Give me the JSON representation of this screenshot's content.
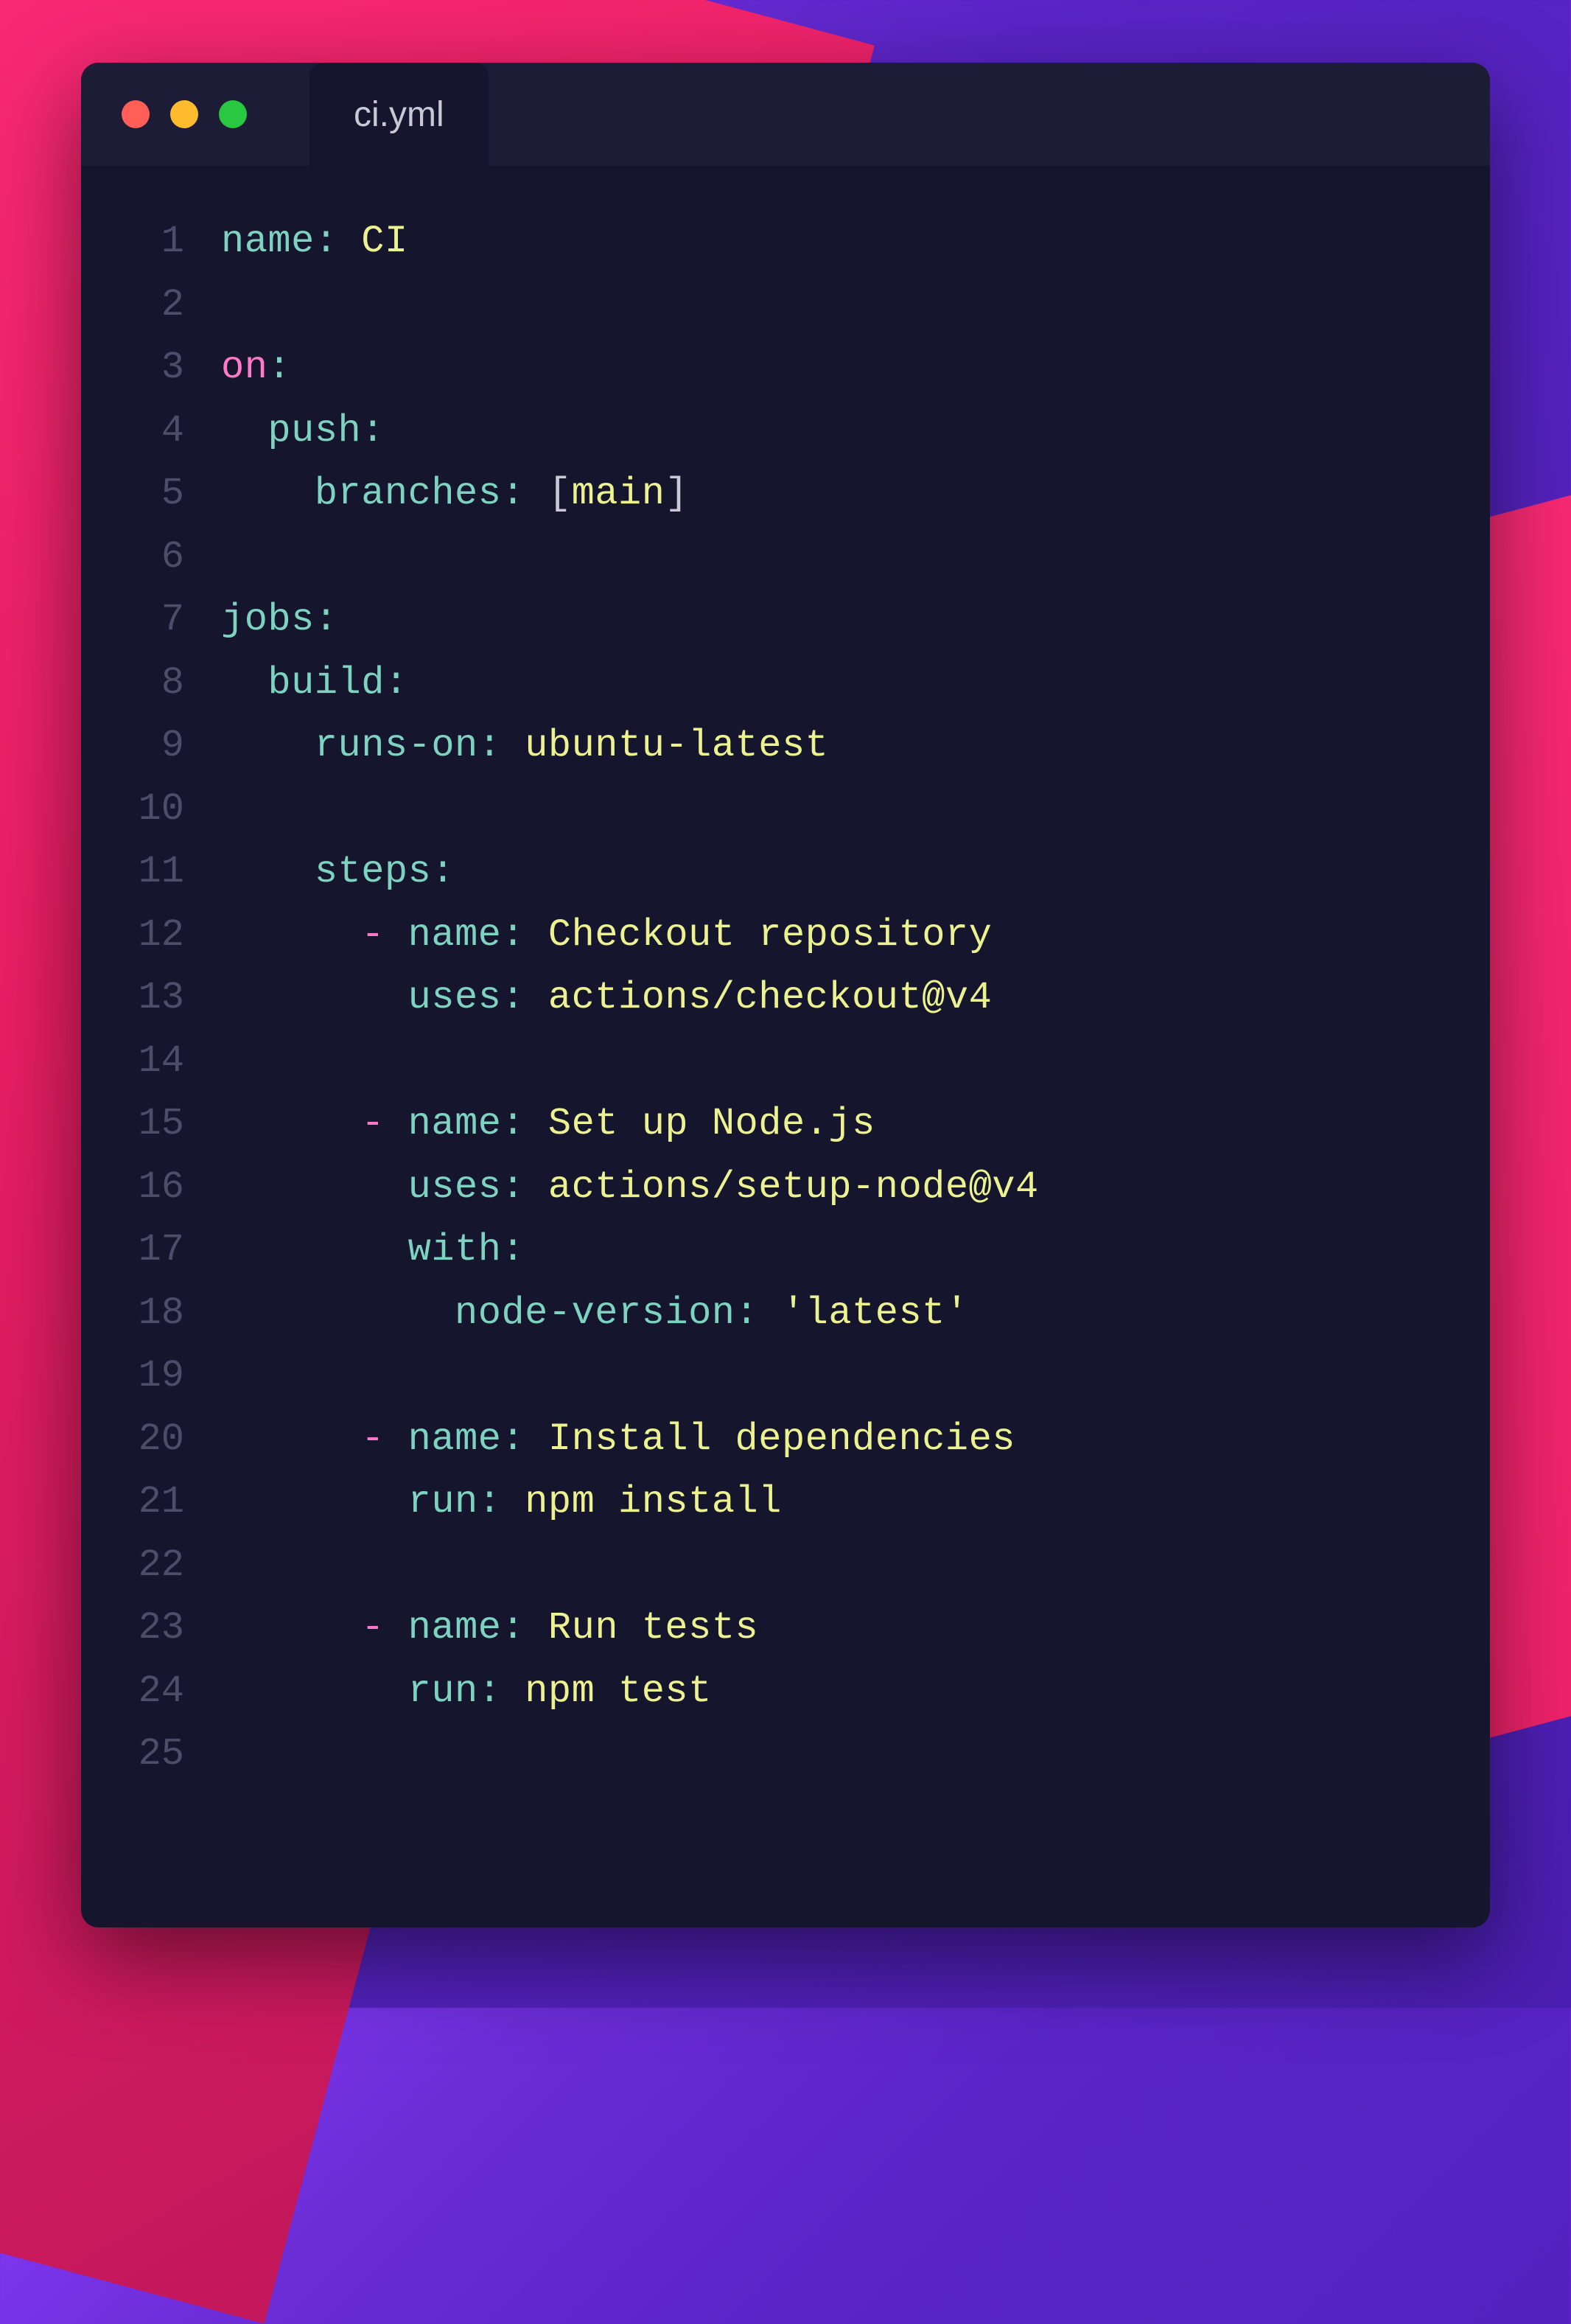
{
  "tab": {
    "filename": "ci.yml"
  },
  "colors": {
    "red": "#ff5f57",
    "yellow": "#febc2e",
    "green": "#28c840"
  },
  "code": {
    "lines": [
      {
        "n": "1",
        "tokens": [
          {
            "c": "tok-key",
            "t": "name"
          },
          {
            "c": "tok-colon",
            "t": ":"
          },
          {
            "c": "tok-string",
            "t": " CI"
          }
        ]
      },
      {
        "n": "2",
        "tokens": []
      },
      {
        "n": "3",
        "tokens": [
          {
            "c": "tok-pink",
            "t": "on"
          },
          {
            "c": "tok-colon",
            "t": ":"
          }
        ]
      },
      {
        "n": "4",
        "tokens": [
          {
            "c": "tok-key",
            "t": "  push"
          },
          {
            "c": "tok-colon",
            "t": ":"
          }
        ]
      },
      {
        "n": "5",
        "tokens": [
          {
            "c": "tok-key",
            "t": "    branches"
          },
          {
            "c": "tok-colon",
            "t": ":"
          },
          {
            "c": "tok-punct",
            "t": " ["
          },
          {
            "c": "tok-val",
            "t": "main"
          },
          {
            "c": "tok-punct",
            "t": "]"
          }
        ]
      },
      {
        "n": "6",
        "tokens": []
      },
      {
        "n": "7",
        "tokens": [
          {
            "c": "tok-key",
            "t": "jobs"
          },
          {
            "c": "tok-colon",
            "t": ":"
          }
        ]
      },
      {
        "n": "8",
        "tokens": [
          {
            "c": "tok-key",
            "t": "  build"
          },
          {
            "c": "tok-colon",
            "t": ":"
          }
        ]
      },
      {
        "n": "9",
        "tokens": [
          {
            "c": "tok-key",
            "t": "    runs-on"
          },
          {
            "c": "tok-colon",
            "t": ":"
          },
          {
            "c": "tok-string",
            "t": " ubuntu-latest"
          }
        ]
      },
      {
        "n": "10",
        "tokens": []
      },
      {
        "n": "11",
        "tokens": [
          {
            "c": "tok-key",
            "t": "    steps"
          },
          {
            "c": "tok-colon",
            "t": ":"
          }
        ]
      },
      {
        "n": "12",
        "tokens": [
          {
            "c": "",
            "t": "      "
          },
          {
            "c": "tok-dash",
            "t": "-"
          },
          {
            "c": "tok-key",
            "t": " name"
          },
          {
            "c": "tok-colon",
            "t": ":"
          },
          {
            "c": "tok-string",
            "t": " Checkout repository"
          }
        ]
      },
      {
        "n": "13",
        "tokens": [
          {
            "c": "tok-key",
            "t": "        uses"
          },
          {
            "c": "tok-colon",
            "t": ":"
          },
          {
            "c": "tok-string",
            "t": " actions/checkout@v4"
          }
        ]
      },
      {
        "n": "14",
        "tokens": []
      },
      {
        "n": "15",
        "tokens": [
          {
            "c": "",
            "t": "      "
          },
          {
            "c": "tok-dash",
            "t": "-"
          },
          {
            "c": "tok-key",
            "t": " name"
          },
          {
            "c": "tok-colon",
            "t": ":"
          },
          {
            "c": "tok-string",
            "t": " Set up Node.js"
          }
        ]
      },
      {
        "n": "16",
        "tokens": [
          {
            "c": "tok-key",
            "t": "        uses"
          },
          {
            "c": "tok-colon",
            "t": ":"
          },
          {
            "c": "tok-string",
            "t": " actions/setup-node@v4"
          }
        ]
      },
      {
        "n": "17",
        "tokens": [
          {
            "c": "tok-key",
            "t": "        with"
          },
          {
            "c": "tok-colon",
            "t": ":"
          }
        ]
      },
      {
        "n": "18",
        "tokens": [
          {
            "c": "tok-key",
            "t": "          node-version"
          },
          {
            "c": "tok-colon",
            "t": ":"
          },
          {
            "c": "tok-quote",
            "t": " 'latest'"
          }
        ]
      },
      {
        "n": "19",
        "tokens": []
      },
      {
        "n": "20",
        "tokens": [
          {
            "c": "",
            "t": "      "
          },
          {
            "c": "tok-dash",
            "t": "-"
          },
          {
            "c": "tok-key",
            "t": " name"
          },
          {
            "c": "tok-colon",
            "t": ":"
          },
          {
            "c": "tok-string",
            "t": " Install dependencies"
          }
        ]
      },
      {
        "n": "21",
        "tokens": [
          {
            "c": "tok-key",
            "t": "        run"
          },
          {
            "c": "tok-colon",
            "t": ":"
          },
          {
            "c": "tok-string",
            "t": " npm install"
          }
        ]
      },
      {
        "n": "22",
        "tokens": []
      },
      {
        "n": "23",
        "tokens": [
          {
            "c": "",
            "t": "      "
          },
          {
            "c": "tok-dash",
            "t": "-"
          },
          {
            "c": "tok-key",
            "t": " name"
          },
          {
            "c": "tok-colon",
            "t": ":"
          },
          {
            "c": "tok-string",
            "t": " Run tests"
          }
        ]
      },
      {
        "n": "24",
        "tokens": [
          {
            "c": "tok-key",
            "t": "        run"
          },
          {
            "c": "tok-colon",
            "t": ":"
          },
          {
            "c": "tok-string",
            "t": " npm test"
          }
        ]
      },
      {
        "n": "25",
        "tokens": []
      }
    ]
  }
}
